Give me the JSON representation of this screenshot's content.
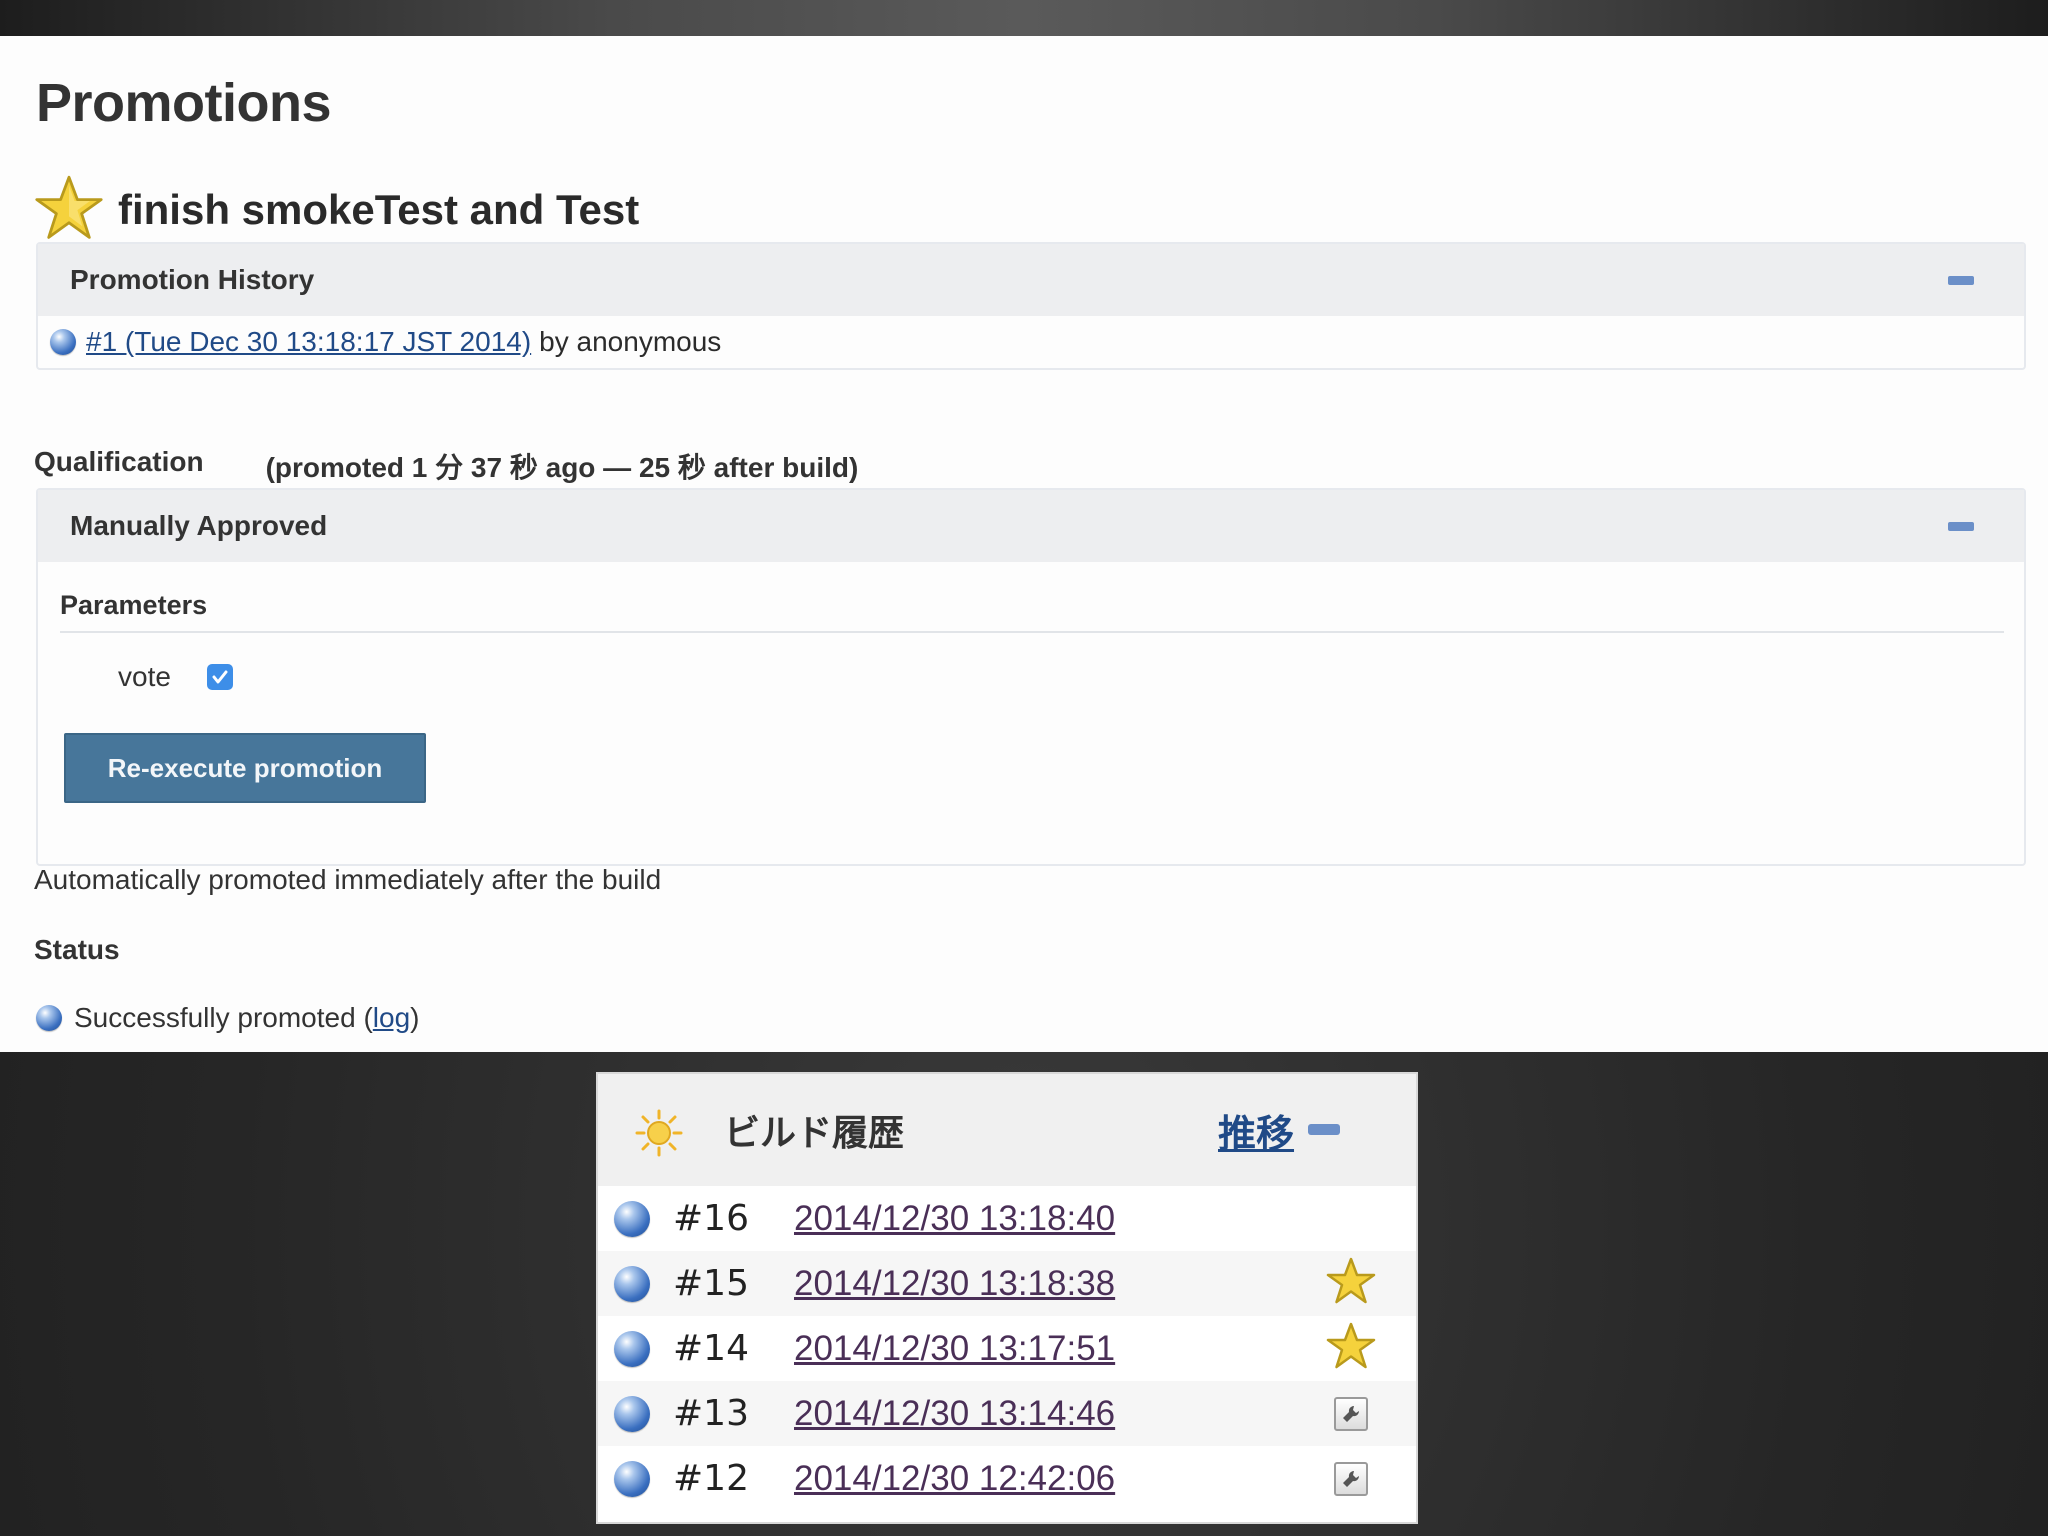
{
  "page": {
    "title": "Promotions"
  },
  "promotion": {
    "name": "finish smokeTest and Test",
    "icon": "star-icon"
  },
  "history": {
    "header": "Promotion History",
    "entry_link": "#1 (Tue Dec 30 13:18:17 JST 2014)",
    "entry_suffix": "by anonymous"
  },
  "qualification": {
    "label": "Qualification",
    "detail": "(promoted 1 分 37 秒 ago — 25 秒 after build)"
  },
  "manual": {
    "header": "Manually Approved",
    "params_title": "Parameters",
    "param_name": "vote",
    "param_checked": true,
    "button_label": "Re-execute promotion"
  },
  "auto_text": "Automatically promoted immediately after the build",
  "status": {
    "title": "Status",
    "text_before": "Successfully promoted (",
    "link": "log",
    "text_after": ")"
  },
  "build_history": {
    "title": "ビルド履歴",
    "trend_link": "推移",
    "builds": [
      {
        "number": "#16",
        "date": "2014/12/30 13:18:40",
        "badge": "none"
      },
      {
        "number": "#15",
        "date": "2014/12/30 13:18:38",
        "badge": "star-icon"
      },
      {
        "number": "#14",
        "date": "2014/12/30 13:17:51",
        "badge": "star-icon"
      },
      {
        "number": "#13",
        "date": "2014/12/30 13:14:46",
        "badge": "wrench-icon"
      },
      {
        "number": "#12",
        "date": "2014/12/30 12:42:06",
        "badge": "wrench-icon"
      }
    ]
  },
  "colors": {
    "link": "#204a87",
    "button": "#47769a",
    "status_ball": "#3a6fc0",
    "collapse": "#6b8fc8",
    "star": "#f5d23c"
  }
}
